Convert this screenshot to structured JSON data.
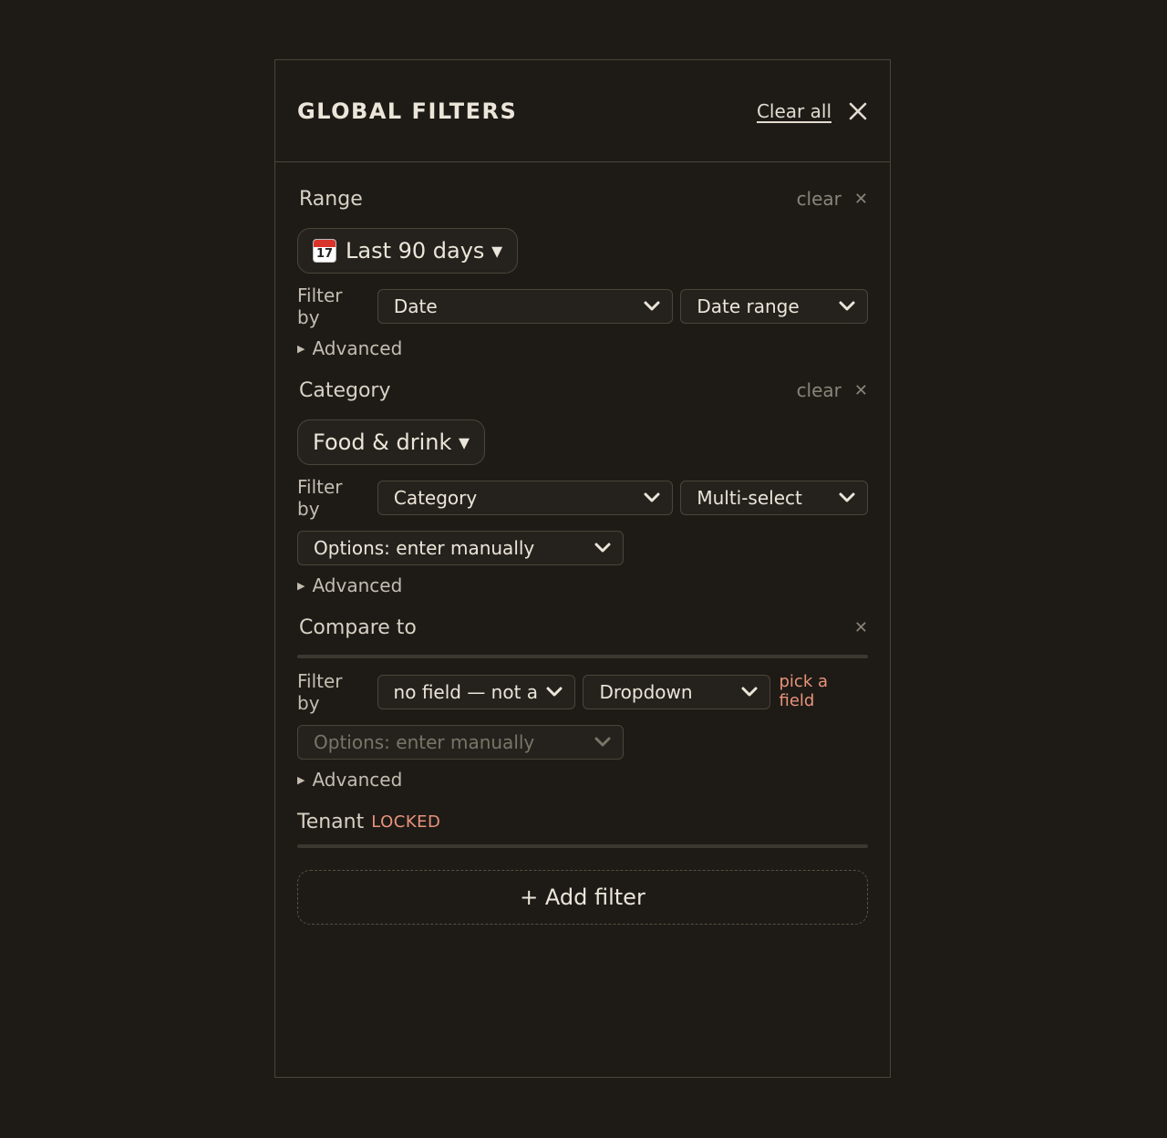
{
  "header": {
    "title": "GLOBAL FILTERS",
    "clear_all_label": "Clear all"
  },
  "filters": [
    {
      "label": "Range",
      "clear_label": "clear",
      "chip_label": "Last 90 days ▾",
      "chip_icon": "calendar-icon",
      "calendar_day": "17",
      "filter_by_label": "Filter by",
      "field": "Date",
      "type": "Date range",
      "advanced_label": "Advanced"
    },
    {
      "label": "Category",
      "clear_label": "clear",
      "chip_label": "Food & drink ▾",
      "filter_by_label": "Filter by",
      "field": "Category",
      "type": "Multi-select",
      "options": "Options: enter manually",
      "advanced_label": "Advanced"
    },
    {
      "label": "Compare to",
      "filter_by_label": "Filter by",
      "field": "no field — not a",
      "type": "Dropdown",
      "warning": "pick a field",
      "options": "Options: enter manually",
      "advanced_label": "Advanced"
    },
    {
      "label": "Tenant",
      "badge": "LOCKED"
    }
  ],
  "add_filter_label": "+ Add filter",
  "colors": {
    "background": "#1e1b17",
    "border": "#4a4539",
    "warning": "#e9937a",
    "muted": "#8a8478"
  }
}
